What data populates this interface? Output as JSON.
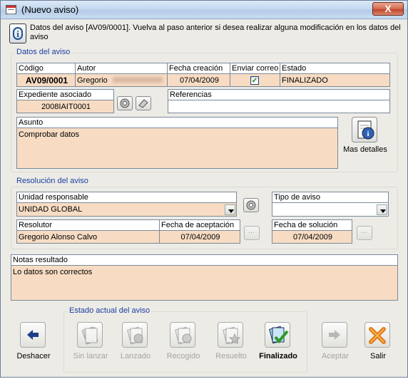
{
  "window": {
    "title": "(Nuevo aviso)",
    "close_label": "X"
  },
  "info": {
    "message": "Datos del aviso [AV09/0001]. Vuelva al paso anterior si desea realizar alguna modificación en los datos del aviso"
  },
  "datos_aviso": {
    "group_title": "Datos del aviso",
    "codigo": {
      "label": "Código",
      "value": "AV09/0001"
    },
    "autor": {
      "label": "Autor",
      "value": "Gregorio"
    },
    "fecha_creacion": {
      "label": "Fecha creación",
      "value": "07/04/2009"
    },
    "enviar_correo": {
      "label": "Enviar correo",
      "checked": true
    },
    "estado": {
      "label": "Estado",
      "value": "FINALIZADO"
    },
    "expediente": {
      "label": "Expediente asociado",
      "value": "2008IAIT0001"
    },
    "referencias": {
      "label": "Referencias",
      "value": ""
    },
    "asunto": {
      "label": "Asunto",
      "value": "Comprobar datos"
    },
    "mas_detalles_label": "Mas detalles"
  },
  "resolucion": {
    "group_title": "Resolución del aviso",
    "unidad": {
      "label": "Unidad responsable",
      "value": "UNIDAD GLOBAL"
    },
    "tipo_aviso": {
      "label": "Tipo de aviso",
      "value": ""
    },
    "resolutor": {
      "label": "Resolutor",
      "value": "Gregorio Alonso Calvo"
    },
    "fecha_aceptacion": {
      "label": "Fecha de aceptación",
      "value": "07/04/2009"
    },
    "fecha_solucion": {
      "label": "Fecha de solución",
      "value": "07/04/2009"
    }
  },
  "notas": {
    "label": "Notas resultado",
    "value": "Lo datos son correctos"
  },
  "estado_actual": {
    "group_title": "Estado actual del aviso",
    "steps": [
      {
        "label": "Sin lanzar",
        "active": false
      },
      {
        "label": "Lanzado",
        "active": false
      },
      {
        "label": "Recogido",
        "active": false
      },
      {
        "label": "Resuelto",
        "active": false
      },
      {
        "label": "Finalizado",
        "active": true
      }
    ]
  },
  "buttons": {
    "deshacer": "Deshacer",
    "aceptar": "Aceptar",
    "salir": "Salir"
  },
  "icons": {
    "window": "form-window-icon",
    "info": "info-icon",
    "expediente_a": "circle-arrow-icon",
    "expediente_b": "eraser-icon",
    "detalles": "document-info-icon",
    "unidad": "circle-arrow-icon",
    "deshacer": "arrow-left-icon",
    "aceptar": "arrow-right-icon",
    "salir": "exit-icon"
  },
  "colors": {
    "field_bg": "#f7dcc3",
    "group_title": "#1b3fa0",
    "window_bg": "#ecebe6"
  }
}
